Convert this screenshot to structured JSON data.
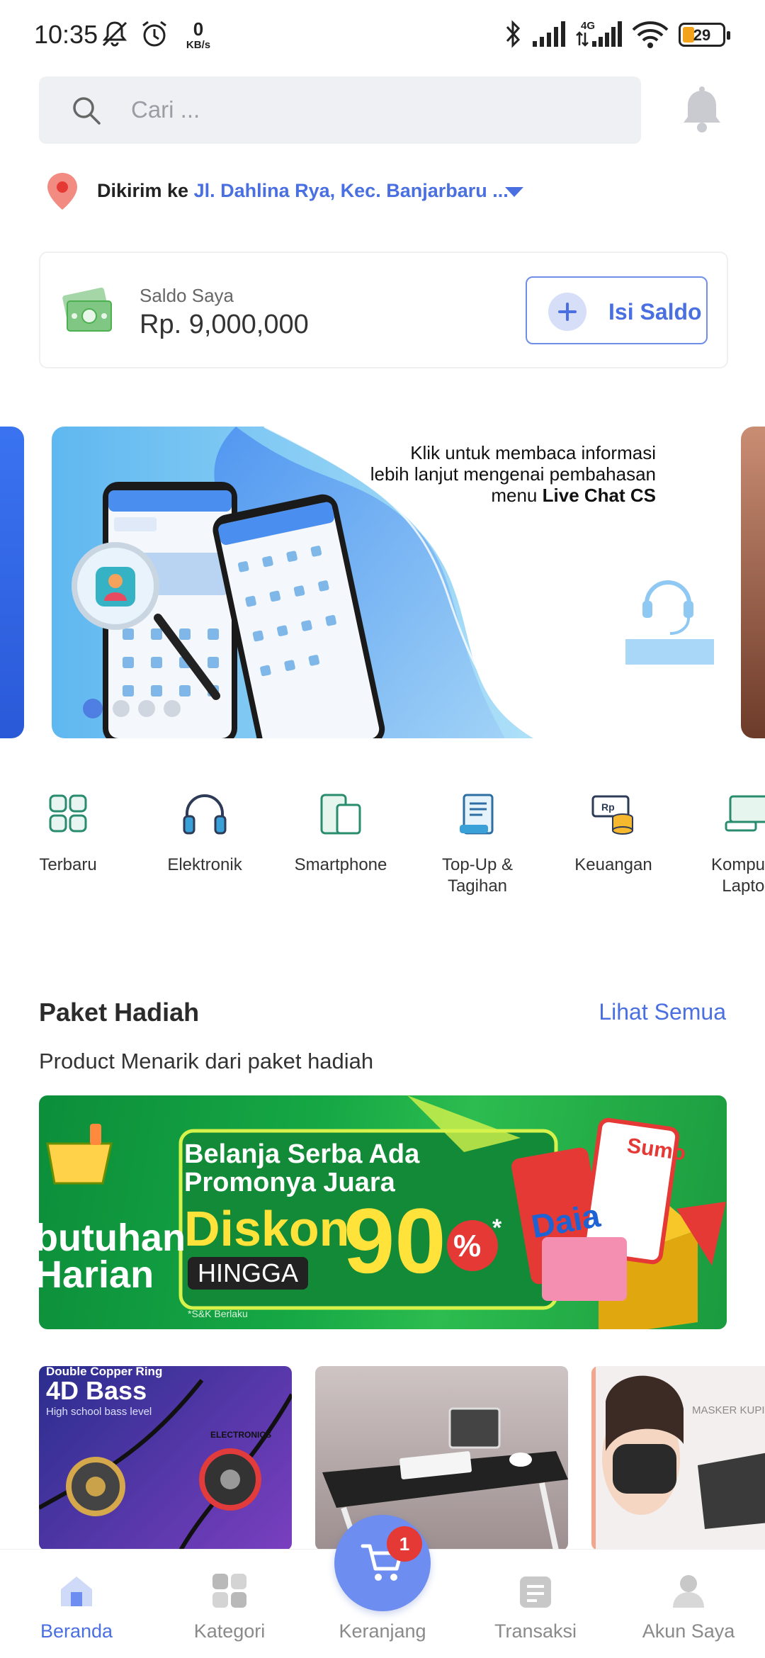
{
  "status_bar": {
    "time": "10:35",
    "net_speed_value": "0",
    "net_speed_unit": "KB/s",
    "network_type": "4G",
    "battery_percent": "29",
    "battery_level": 0.29,
    "icons": [
      "mute-icon",
      "alarm-icon",
      "bluetooth-icon",
      "signal-icon",
      "signal-4g-icon",
      "wifi-icon",
      "battery-icon"
    ]
  },
  "search": {
    "placeholder": "Cari ..."
  },
  "address": {
    "label": "Dikirim ke",
    "value": "Jl. Dahlina Rya, Kec. Banjarbaru ..."
  },
  "saldo": {
    "title": "Saldo Saya",
    "amount": "Rp. 9,000,000",
    "button": "Isi Saldo"
  },
  "banner": {
    "line1": "Klik untuk membaca informasi",
    "line2": "lebih lanjut mengenai pembahasan",
    "line3_prefix": "menu",
    "line3_bold": "Live Chat CS"
  },
  "categories": [
    {
      "label": "Terbaru",
      "icon": "grid-icon"
    },
    {
      "label": "Elektronik",
      "icon": "headphones-icon"
    },
    {
      "label": "Smartphone",
      "icon": "devices-icon"
    },
    {
      "label": "Top-Up & Tagihan",
      "icon": "receipt-icon"
    },
    {
      "label": "Keuangan",
      "icon": "money-icon"
    },
    {
      "label_line1": "Komputer",
      "label_line2": "Laptop",
      "icon": "computer-icon"
    }
  ],
  "paket": {
    "title": "Paket Hadiah",
    "link": "Lihat Semua",
    "subtitle": "Product Menarik dari paket hadiah"
  },
  "promo": {
    "line1": "Belanja Serba Ada",
    "line2": "Promonya Juara",
    "left1": "butuhan",
    "left2": "Harian",
    "diskon": "Diskon",
    "hingga": "HINGGA",
    "number": "90",
    "percent": "%",
    "asterisk": "*",
    "note": "*S&K Berlaku",
    "brand1": "Daia",
    "brand2": "Sumo"
  },
  "products": [
    {
      "name": "earphones",
      "text1": "Double Copper Ring",
      "text2": "4D Bass",
      "text3": "High school bass level",
      "brand": "ELECTRONICS"
    },
    {
      "name": "laptop-table"
    },
    {
      "name": "mask",
      "text1": "MASKER KUPIN"
    }
  ],
  "bottom_nav": {
    "items": [
      {
        "label": "Beranda",
        "icon": "home-icon",
        "active": true
      },
      {
        "label": "Kategori",
        "icon": "category-icon"
      },
      {
        "label": "Keranjang",
        "icon": "cart-icon",
        "badge": "1"
      },
      {
        "label": "Transaksi",
        "icon": "transaction-icon"
      },
      {
        "label": "Akun Saya",
        "icon": "profile-icon"
      }
    ]
  },
  "colors": {
    "accent": "#4a6fe0",
    "fab": "#6d8df0",
    "badge": "#e53935",
    "promo_green": "#16a845"
  }
}
